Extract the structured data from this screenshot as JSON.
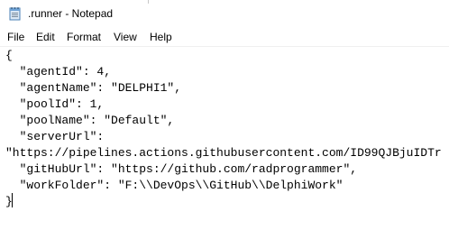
{
  "window": {
    "title": ".runner - Notepad"
  },
  "menu": {
    "items": [
      "File",
      "Edit",
      "Format",
      "View",
      "Help"
    ]
  },
  "editor": {
    "lines": [
      "{",
      "  \"agentId\": 4,",
      "  \"agentName\": \"DELPHI1\",",
      "  \"poolId\": 1,",
      "  \"poolName\": \"Default\",",
      "  \"serverUrl\":",
      "\"https://pipelines.actions.githubusercontent.com/ID99QJBjuIDTr",
      "  \"gitHubUrl\": \"https://github.com/radprogrammer\",",
      "  \"workFolder\": \"F:\\\\DevOps\\\\GitHub\\\\DelphiWork\"",
      "}"
    ]
  },
  "icons": {
    "app_icon": "notepad-icon"
  }
}
